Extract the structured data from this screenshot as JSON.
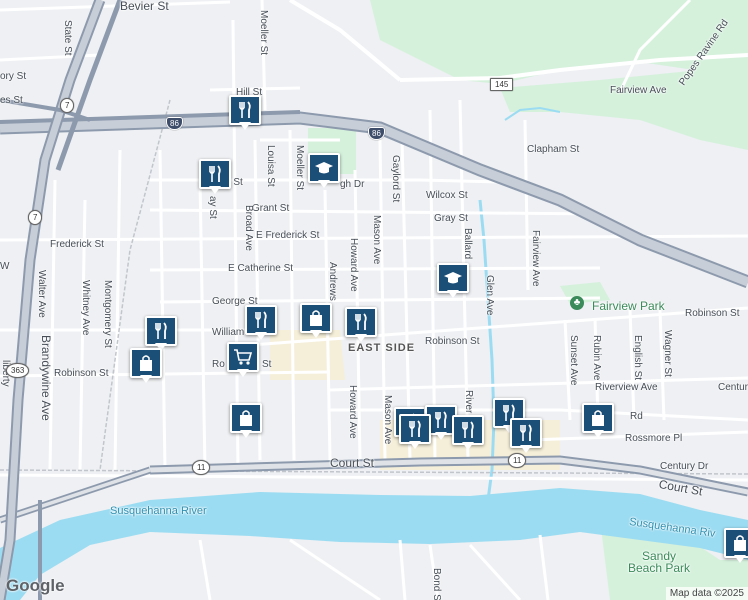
{
  "map": {
    "colors": {
      "water": "#9cdcf2",
      "park": "#d5f1dc",
      "highway": "#8d9aad",
      "road": "#ffffff",
      "marker": "#1b4f78",
      "industrial": "#f5efd9"
    },
    "streets": {
      "bevier": "Bevier St",
      "state": "State St",
      "moeller_top": "Moeller St",
      "hill": "Hill St",
      "fairview_ave_top": "Fairview Ave",
      "popes_ravine": "Popes Ravine Rd",
      "clapham": "Clapham St",
      "louisa": "Louisa St",
      "moeller": "Moeller St",
      "gaylord": "Gaylord St",
      "burleigh": "gh Dr",
      "wilcox": "Wilcox St",
      "grant": "Grant St",
      "gray": "Gray St",
      "frederick": "Frederick St",
      "e_frederick": "E Frederick St",
      "broad": "Broad Ave",
      "mason": "Mason Ave",
      "howard": "Howard Ave",
      "ballard": "Ballard",
      "fairview_ave": "Fairview Ave",
      "walter": "Walter Ave",
      "whitney": "Whitney Ave",
      "montgomery": "Montgomery St",
      "e_catherine": "E Catherine St",
      "andrews": "Andrews",
      "glen": "Glen Ave",
      "george": "George St",
      "robinson_w": "Robinson St",
      "robinson_e": "Robinson St",
      "robinson_mid": "Robinson St",
      "robinson_far": "Robinson St",
      "william": "William",
      "sunset": "Sunset Ave",
      "rubin": "Rubin Ave",
      "english": "English St",
      "wagner": "Wagner St",
      "riverview": "Riverview Ave",
      "centur": "Centur",
      "howard_s": "Howard Ave",
      "mason_s": "Mason Ave",
      "rossmore": "Rossmore Pl",
      "rd_frag": "Rd",
      "court_w": "Court St",
      "court_e": "Court St",
      "century": "Century Dr",
      "brandywine": "Brandywine Ave",
      "river_frag": "River",
      "bond": "Bond S",
      "ay_st": "ay St",
      "ott_st": "tt St",
      "ory_st": "ory St",
      "es_st": "es St",
      "rd_st": "rd St",
      "ro_frag": "Ro",
      "st_frag": "St",
      "b_frag": "B",
      "g_frag": "G",
      "d_frag": "D",
      "fe_frag": "Fe",
      "ho_frag": "Ho",
      "ho_frag2": "Ho",
      "w_frag": "W",
      "liberty": "liberty"
    },
    "route_shields": {
      "i86_w": "86",
      "i86_e": "86",
      "r145": "145",
      "r7_top": "7",
      "r7_mid": "7",
      "r363": "363",
      "r11_w": "11",
      "r11_e": "11"
    },
    "neighborhood": "EAST SIDE",
    "river": "Susquehanna River",
    "river_right": "Susquehanna Riv",
    "parks": {
      "fairview": "Fairview Park",
      "sandy_beach": "Sandy\nBeach Park"
    },
    "markers": [
      {
        "type": "restaurant",
        "icon": "fork-knife-icon"
      },
      {
        "type": "restaurant",
        "icon": "fork-knife-icon"
      },
      {
        "type": "school",
        "icon": "graduation-cap-icon"
      },
      {
        "type": "school",
        "icon": "graduation-cap-icon"
      },
      {
        "type": "restaurant",
        "icon": "fork-knife-icon"
      },
      {
        "type": "shopping",
        "icon": "shopping-bag-icon"
      },
      {
        "type": "restaurant",
        "icon": "fork-knife-icon"
      },
      {
        "type": "restaurant",
        "icon": "fork-knife-icon"
      },
      {
        "type": "shopping",
        "icon": "shopping-bag-icon"
      },
      {
        "type": "grocery",
        "icon": "shopping-cart-icon"
      },
      {
        "type": "shopping",
        "icon": "shopping-bag-icon"
      },
      {
        "type": "restaurant",
        "icon": "fork-knife-icon"
      },
      {
        "type": "restaurant",
        "icon": "fork-knife-icon"
      },
      {
        "type": "restaurant",
        "icon": "fork-knife-icon"
      },
      {
        "type": "restaurant",
        "icon": "fork-knife-icon"
      },
      {
        "type": "restaurant",
        "icon": "fork-knife-icon"
      },
      {
        "type": "restaurant",
        "icon": "fork-knife-icon"
      },
      {
        "type": "shopping",
        "icon": "shopping-bag-icon"
      },
      {
        "type": "shopping",
        "icon": "shopping-bag-icon"
      }
    ],
    "logo": "Google",
    "attribution": "Map data ©2025"
  }
}
